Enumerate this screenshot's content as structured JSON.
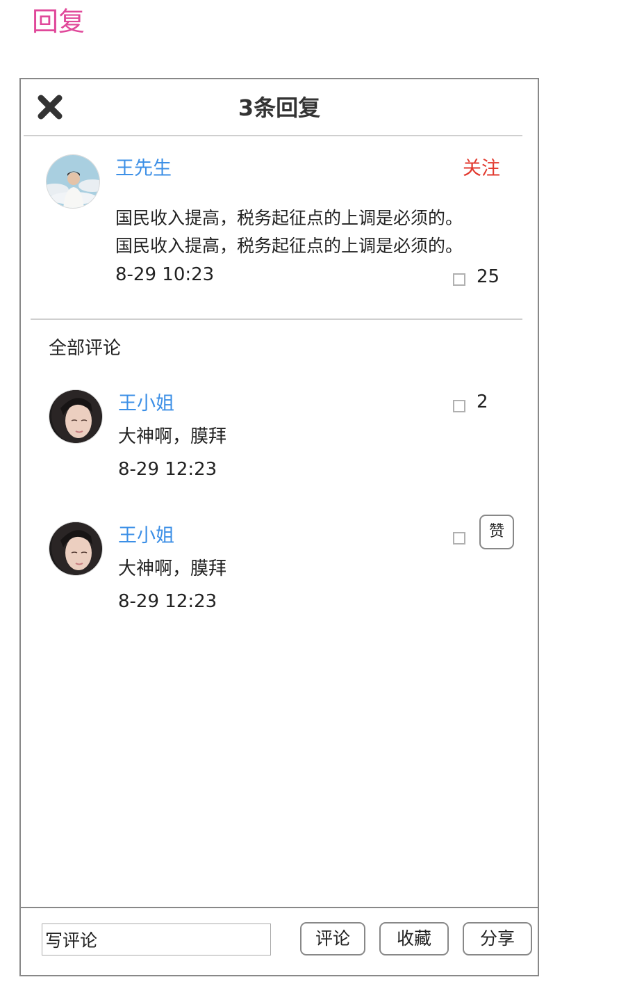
{
  "page_heading": "回复",
  "panel": {
    "title": "3条回复",
    "close_icon": "close-icon"
  },
  "main_post": {
    "author": "王先生",
    "follow_label": "关注",
    "lines": [
      "国民收入提高，税务起征点的上调是必须的。",
      "国民收入提高，税务起征点的上调是必须的。"
    ],
    "time": "8-29 10:23",
    "like_count": "25"
  },
  "comments_section": {
    "label": "全部评论",
    "items": [
      {
        "author": "王小姐",
        "text": "大神啊，膜拜",
        "time": "8-29 12:23",
        "like_count": "2"
      },
      {
        "author": "王小姐",
        "text": "大神啊，膜拜",
        "time": "8-29 12:23",
        "praise_label": "赞"
      }
    ]
  },
  "bottom_bar": {
    "input_value": "写评论",
    "comment_label": "评论",
    "collect_label": "收藏",
    "share_label": "分享"
  },
  "colors": {
    "heading": "#e0489a",
    "name_link": "#3c8fe6",
    "follow": "#e23a2f"
  }
}
